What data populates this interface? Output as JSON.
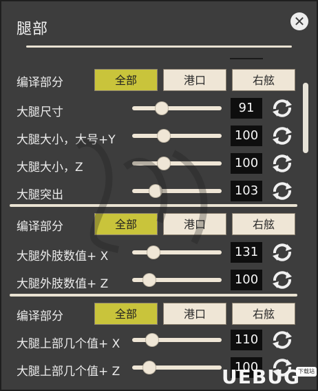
{
  "window": {
    "title": "腿部"
  },
  "groups": [
    {
      "label": "编译部分",
      "buttons": [
        {
          "label": "全部",
          "active": true
        },
        {
          "label": "港口",
          "active": false
        },
        {
          "label": "右舷",
          "active": false
        }
      ],
      "sliders": [
        {
          "label": "大腿尺寸",
          "value": "91",
          "fraction": 0.33
        },
        {
          "label": "大腿大小，大号+Y",
          "value": "100",
          "fraction": 0.35
        },
        {
          "label": "大腿大小，Z",
          "value": "100",
          "fraction": 0.35
        },
        {
          "label": "大腿突出",
          "value": "103",
          "fraction": 0.26
        }
      ]
    },
    {
      "label": "编译部分",
      "buttons": [
        {
          "label": "全部",
          "active": true
        },
        {
          "label": "港口",
          "active": false
        },
        {
          "label": "右舷",
          "active": false
        }
      ],
      "sliders": [
        {
          "label": "大腿外肢数值+ X",
          "value": "131",
          "fraction": 0.24
        },
        {
          "label": "大腿外肢数值+ Z",
          "value": "100",
          "fraction": 0.19
        }
      ]
    },
    {
      "label": "编译部分",
      "buttons": [
        {
          "label": "全部",
          "active": true
        },
        {
          "label": "港口",
          "active": false
        },
        {
          "label": "右舷",
          "active": false
        }
      ],
      "sliders": [
        {
          "label": "大腿上部几个值+ X",
          "value": "110",
          "fraction": 0.22
        },
        {
          "label": "大腿上部几个值+ Z",
          "value": "100",
          "fraction": 0.19
        }
      ]
    }
  ],
  "logo": {
    "text": "UEBUG",
    "tag": "下载站"
  },
  "colors": {
    "accent": "#c9c43b",
    "panel": "#3d3d3d",
    "button": "#efe6d6",
    "value_bg": "#0e0e0e"
  }
}
